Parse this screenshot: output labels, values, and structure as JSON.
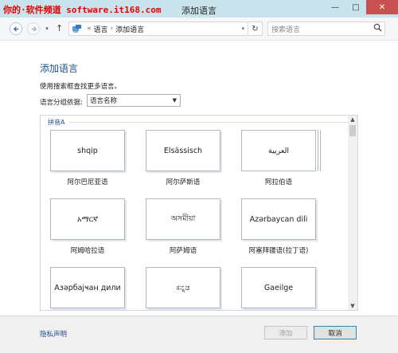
{
  "watermark": "你的·软件频道 software.it168.com",
  "window": {
    "title": "添加语言",
    "minimize": "—",
    "maximize": "□",
    "close": "✕"
  },
  "nav": {
    "back_icon": "back-arrow-icon",
    "forward_icon": "forward-arrow-icon",
    "up": "↑",
    "breadcrumb_overflow": "«",
    "breadcrumb": [
      "语言",
      "添加语言"
    ],
    "refresh": "↻",
    "search_placeholder": "搜索语言"
  },
  "page": {
    "heading": "添加语言",
    "description": "使用搜索框查找更多语言。",
    "group_label": "语言分组依据:",
    "group_value": "语言名称"
  },
  "list": {
    "section": "拼音A",
    "tiles": [
      {
        "native": "shqip",
        "label": "阿尔巴尼亚语"
      },
      {
        "native": "Elsässisch",
        "label": "阿尔萨斯语"
      },
      {
        "native": "العربية",
        "label": "阿拉伯语"
      },
      {
        "native": "አማርኛ",
        "label": "阿姆哈拉语"
      },
      {
        "native": "অসমীয়া",
        "label": "阿萨姆语"
      },
      {
        "native": "Azərbaycan dili",
        "label": "阿塞拜疆语(拉丁语)"
      },
      {
        "native": "Азәрбајҹан дили",
        "label": ""
      },
      {
        "native": "ಕನ್ನಡ",
        "label": ""
      },
      {
        "native": "Gaeilge",
        "label": ""
      }
    ]
  },
  "footer": {
    "privacy": "隐私声明",
    "add": "添加",
    "cancel": "取消"
  },
  "colors": {
    "accent": "#1e4e8c",
    "titlebar": "#c9e3ec",
    "close": "#c75050"
  }
}
